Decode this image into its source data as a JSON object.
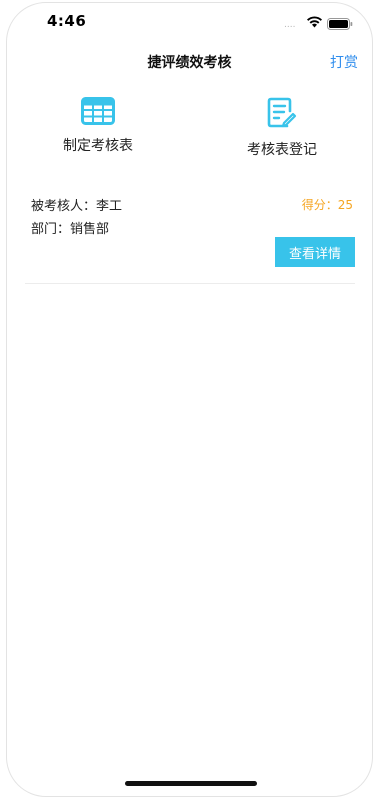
{
  "status_bar": {
    "time": "4:46",
    "signal": "....",
    "icons": [
      "wifi-icon",
      "battery-icon"
    ]
  },
  "nav": {
    "title": "捷评绩效考核",
    "action_label": "打赏"
  },
  "actions": [
    {
      "label": "制定考核表",
      "icon": "table-icon"
    },
    {
      "label": "考核表登记",
      "icon": "edit-document-icon"
    }
  ],
  "record": {
    "person": "被考核人：李工",
    "department": "部门：销售部",
    "score": "得分：25",
    "detail_label": "查看详情"
  },
  "colors": {
    "accent": "#38c3ea",
    "link": "#2f8ded",
    "score": "#f5a623"
  }
}
